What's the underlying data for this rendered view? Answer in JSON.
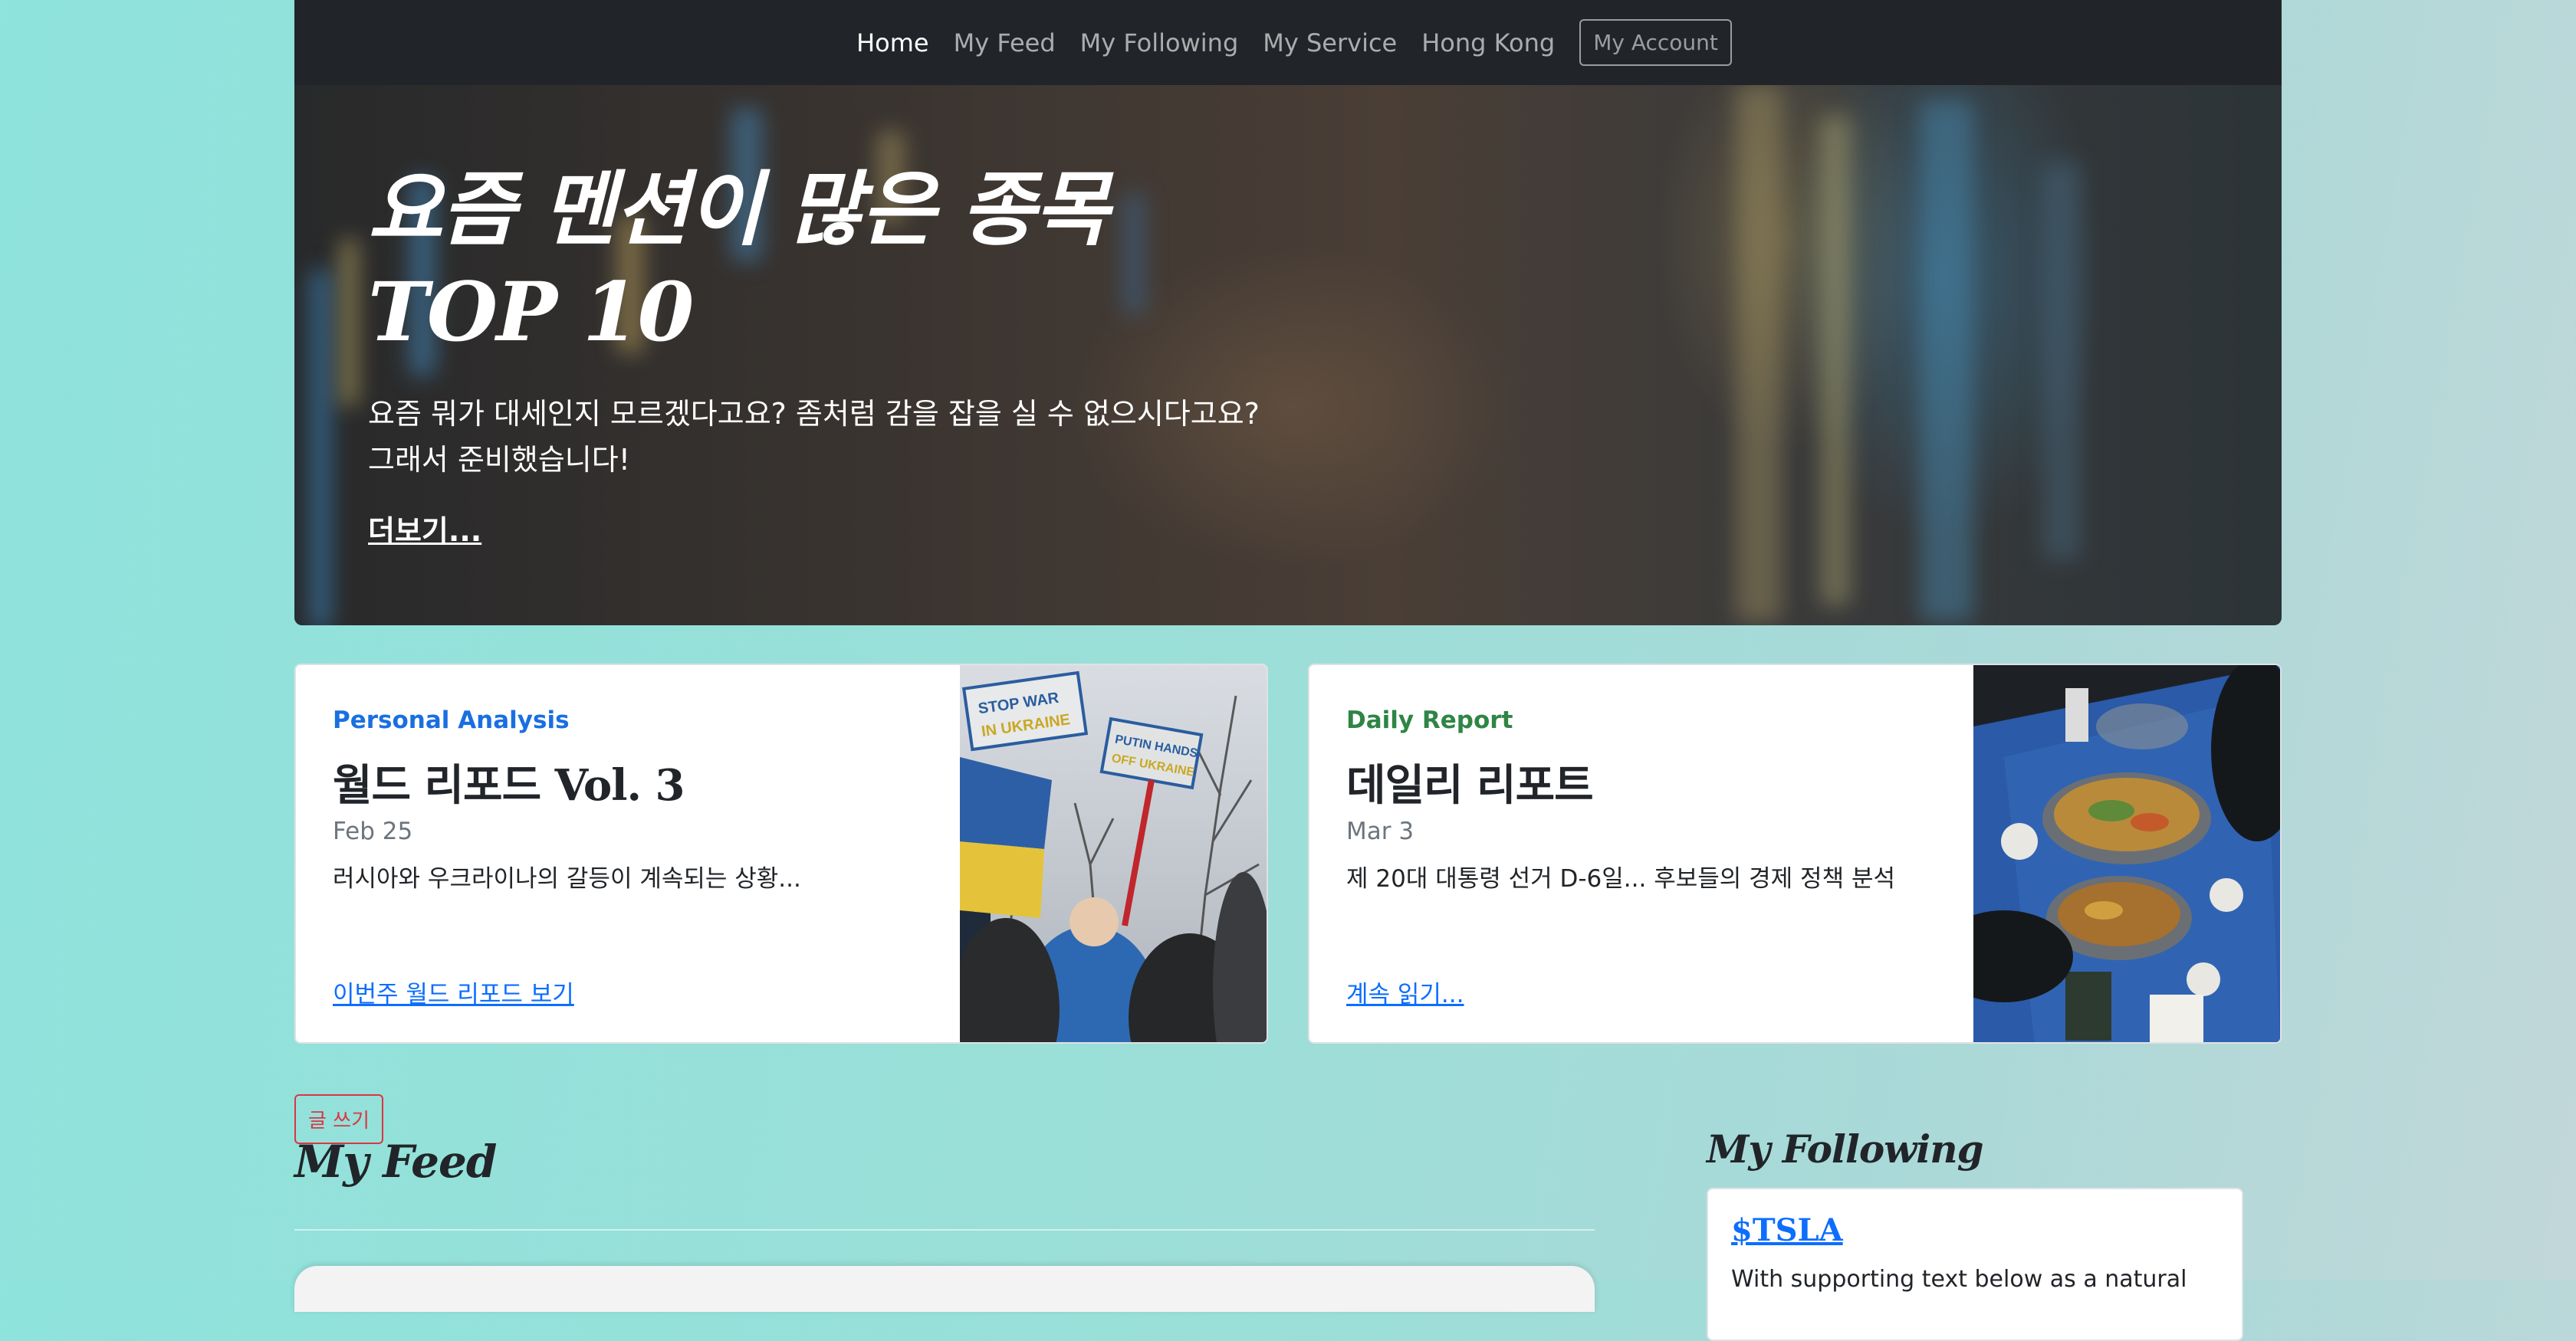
{
  "nav": {
    "items": [
      "Home",
      "My Feed",
      "My Following",
      "My Service",
      "Hong Kong"
    ],
    "account_label": "My Account"
  },
  "hero": {
    "title_line1": "요즘 멘션이 많은 종목",
    "title_line2": "TOP 10",
    "text_line1": "요즘 뭐가 대세인지 모르겠다고요? 좀처럼 감을 잡을 실 수 없으시다고요?",
    "text_line2": "그래서 준비했습니다!",
    "link": "더보기..."
  },
  "cards": [
    {
      "category": "Personal Analysis",
      "category_color": "#1a6fe0",
      "title": "월드 리포드 Vol. 3",
      "date": "Feb 25",
      "text": "러시아와 우크라이나의 갈등이 계속되는 상황...",
      "link": "이번주 월드 리포드 보기",
      "image": "ukraine-protest-photo"
    },
    {
      "category": "Daily Report",
      "category_color": "#2e8545",
      "title": "데일리 리포트",
      "date": "Mar 3",
      "text": "제 20대 대통령 선거 D-6일... 후보들의 경제 정책 분석",
      "link": "계속 읽기...",
      "image": "street-food-photo"
    }
  ],
  "feed": {
    "write_label": "글 쓰기",
    "title": "My Feed"
  },
  "following": {
    "title": "My Following",
    "card_title": "$TSLA",
    "card_text": "With supporting text below as a natural"
  }
}
